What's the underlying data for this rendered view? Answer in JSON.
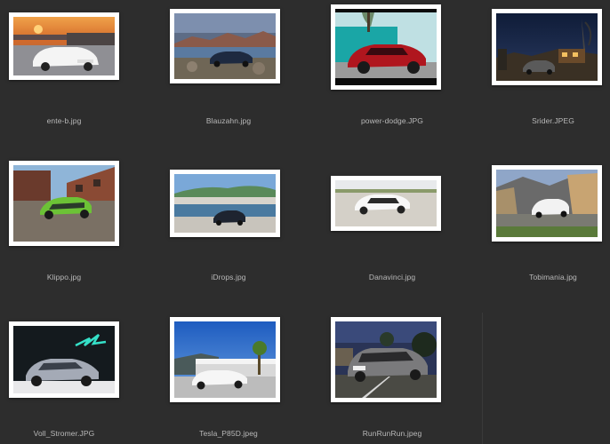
{
  "window": {
    "title": ""
  },
  "files": [
    {
      "name": "ente-b.jpg",
      "icon": "image-thumbnail-icon",
      "scene": "sunset-white-sedan"
    },
    {
      "name": "Blauzahn.jpg",
      "icon": "image-thumbnail-icon",
      "scene": "mountain-lake-dark-sedan"
    },
    {
      "name": "power-dodge.JPG",
      "icon": "image-thumbnail-icon",
      "scene": "red-suv-modern-building"
    },
    {
      "name": "Srider.JPEG",
      "icon": "image-thumbnail-icon",
      "scene": "night-street-car"
    },
    {
      "name": "Klippo.jpg",
      "icon": "image-thumbnail-icon",
      "scene": "green-wrapped-car-brick"
    },
    {
      "name": "iDrops.jpg",
      "icon": "image-thumbnail-icon",
      "scene": "harbor-town-dark-sedan"
    },
    {
      "name": "Danavinci.jpg",
      "icon": "image-thumbnail-icon",
      "scene": "white-suv-gravel"
    },
    {
      "name": "Tobimania.jpg",
      "icon": "image-thumbnail-icon",
      "scene": "white-suv-autumn-road"
    },
    {
      "name": "Voll_Stromer.JPG",
      "icon": "image-thumbnail-icon",
      "scene": "silver-suv-neon-wall"
    },
    {
      "name": "Tesla_P85D.jpeg",
      "icon": "image-thumbnail-icon",
      "scene": "white-sedan-blue-sky"
    },
    {
      "name": "RunRunRun.jpeg",
      "icon": "image-thumbnail-icon",
      "scene": "grey-suv-parking-dusk"
    }
  ],
  "colors": {
    "background": "#2d2d2d",
    "label": "#b9b9b9",
    "frame": "#ffffff"
  }
}
